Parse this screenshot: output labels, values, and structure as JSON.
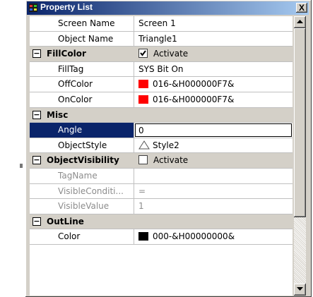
{
  "window": {
    "title": "Property List",
    "close_label": "X"
  },
  "rows": [
    {
      "type": "prop",
      "name": "Screen Name",
      "value": "Screen 1"
    },
    {
      "type": "prop",
      "name": "Object Name",
      "value": "Triangle1"
    },
    {
      "type": "category",
      "name": "FillColor",
      "expander": "−",
      "checkbox": true,
      "checked": true,
      "value": "Activate"
    },
    {
      "type": "prop",
      "name": "FillTag",
      "value": "SYS Bit On"
    },
    {
      "type": "prop",
      "name": "OffColor",
      "swatch": "#ff0000",
      "value": "016-&H000000F7&"
    },
    {
      "type": "prop",
      "name": "OnColor",
      "swatch": "#ff0000",
      "value": "016-&H000000F7&"
    },
    {
      "type": "category",
      "name": "Misc",
      "expander": "−"
    },
    {
      "type": "prop",
      "name": "Angle",
      "value": "0",
      "selected": true
    },
    {
      "type": "prop",
      "name": "ObjectStyle",
      "icon": "triangle-icon",
      "value": "Style2"
    },
    {
      "type": "category",
      "name": "ObjectVisibility",
      "expander": "−",
      "checkbox": true,
      "checked": false,
      "value": "Activate"
    },
    {
      "type": "prop",
      "name": "TagName",
      "value": "",
      "disabled": true
    },
    {
      "type": "prop",
      "name": "VisibleConditi...",
      "value": "=",
      "disabled": true
    },
    {
      "type": "prop",
      "name": "VisibleValue",
      "value": "1",
      "disabled": true
    },
    {
      "type": "category",
      "name": "OutLine",
      "expander": "−"
    },
    {
      "type": "prop",
      "name": "Color",
      "swatch": "#000000",
      "value": "000-&H00000000&"
    }
  ],
  "icons": {
    "app": "app-icon",
    "close": "close-icon",
    "scroll_up": "scroll-up-arrow-icon",
    "scroll_down": "scroll-down-arrow-icon"
  }
}
